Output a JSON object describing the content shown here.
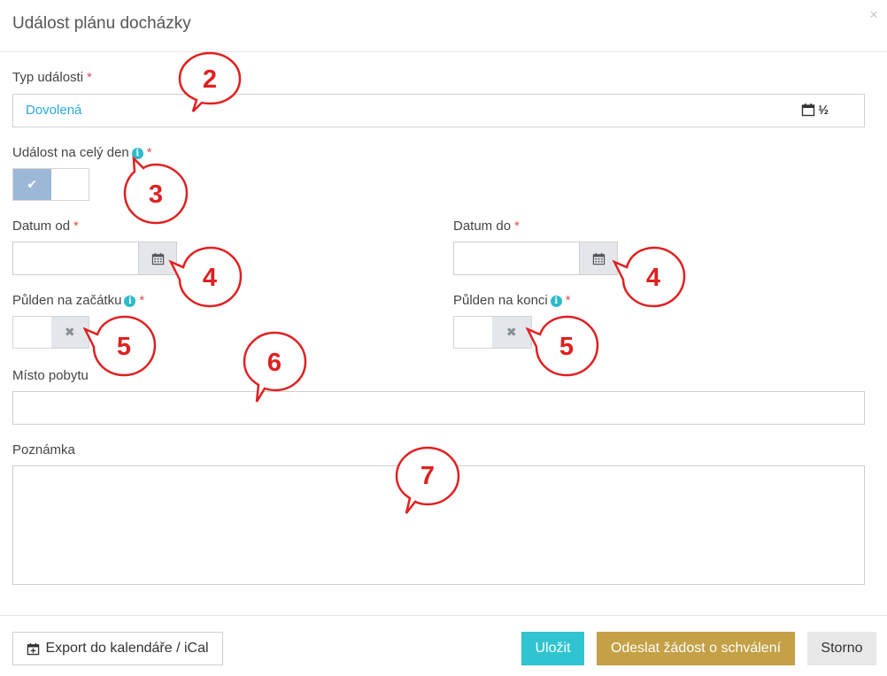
{
  "dialog": {
    "title": "Událost plánu docházky",
    "close_glyph": "×"
  },
  "form": {
    "event_type": {
      "label": "Typ události",
      "required_mark": "*",
      "value": "Dovolená",
      "suffix": "½"
    },
    "all_day": {
      "label": "Událost na celý den",
      "required_mark": "*",
      "info_glyph": "i",
      "checked": true,
      "check_glyph": "✔"
    },
    "date_from": {
      "label": "Datum od",
      "required_mark": "*",
      "value": ""
    },
    "date_to": {
      "label": "Datum do",
      "required_mark": "*",
      "value": ""
    },
    "half_start": {
      "label": "Půlden na začátku",
      "required_mark": "*",
      "info_glyph": "i",
      "x_glyph": "✖"
    },
    "half_end": {
      "label": "Půlden na konci",
      "required_mark": "*",
      "info_glyph": "i",
      "x_glyph": "✖"
    },
    "location": {
      "label": "Místo pobytu",
      "value": ""
    },
    "note": {
      "label": "Poznámka",
      "value": ""
    }
  },
  "footer": {
    "export_label": "Export do kalendáře / iCal",
    "save_label": "Uložit",
    "send_label": "Odeslat žádost o schválení",
    "cancel_label": "Storno"
  },
  "callouts": [
    "2",
    "3",
    "4",
    "4",
    "5",
    "5",
    "6",
    "7"
  ],
  "colors": {
    "accent_link": "#2aa8d8",
    "save": "#2fc4d0",
    "send": "#c4a046",
    "callout": "#e02020",
    "required": "#d9534f"
  }
}
